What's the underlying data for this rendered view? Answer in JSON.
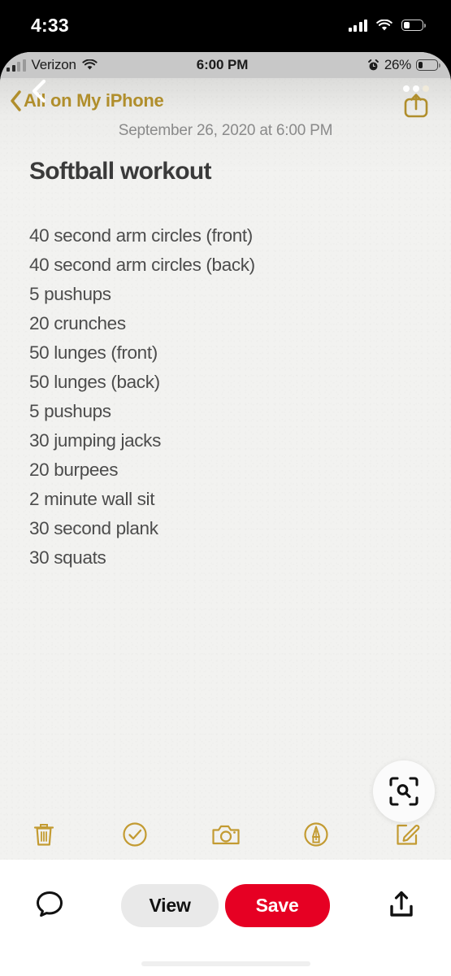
{
  "device_status_bar": {
    "clock": "4:33",
    "signal_icon": "cellular-signal-icon",
    "wifi_icon": "wifi-icon",
    "battery_icon": "battery-icon",
    "battery_level_pct": 32
  },
  "note_screenshot": {
    "ios_status_bar": {
      "carrier": "Verizon",
      "signal_icon": "cellular-signal-icon",
      "wifi_icon": "wifi-icon",
      "time": "6:00 PM",
      "alarm_icon": "alarm-clock-icon",
      "battery_percent": "26%",
      "battery_icon": "battery-icon",
      "battery_level_pct": 26
    },
    "navbar": {
      "back_label": "All on My iPhone",
      "back_icon": "chevron-left-icon",
      "cursor_icon": "cursor-chevron-icon",
      "share_icon": "share-icon",
      "loading_dots_icon": "ellipsis-dots-icon"
    },
    "date": "September 26, 2020 at 6:00 PM",
    "title": "Softball workout",
    "lines": [
      "40 second arm circles (front)",
      "40 second arm circles (back)",
      "5 pushups",
      "20 crunches",
      "50 lunges (front)",
      "50 lunges (back)",
      "5 pushups",
      "30 jumping jacks",
      "20 burpees",
      "2 minute wall sit",
      "30 second plank",
      "30 squats"
    ],
    "toolbar": [
      {
        "name": "delete-button",
        "icon": "trash-icon"
      },
      {
        "name": "checklist-button",
        "icon": "check-circle-icon"
      },
      {
        "name": "camera-button",
        "icon": "camera-icon"
      },
      {
        "name": "markup-button",
        "icon": "markup-pen-icon"
      },
      {
        "name": "compose-button",
        "icon": "compose-icon"
      }
    ],
    "scan_button": {
      "icon": "visual-lookup-scan-icon"
    }
  },
  "pinterest_bar": {
    "comment_icon": "comment-bubble-icon",
    "view_label": "View",
    "save_label": "Save",
    "share_icon": "share-upload-icon",
    "home_indicator": "home-indicator"
  },
  "colors": {
    "accent_gold": "#B08E2C",
    "pinterest_red": "#E60023",
    "note_paper": "#F2F2F0",
    "body_text": "#4C4C4C"
  }
}
